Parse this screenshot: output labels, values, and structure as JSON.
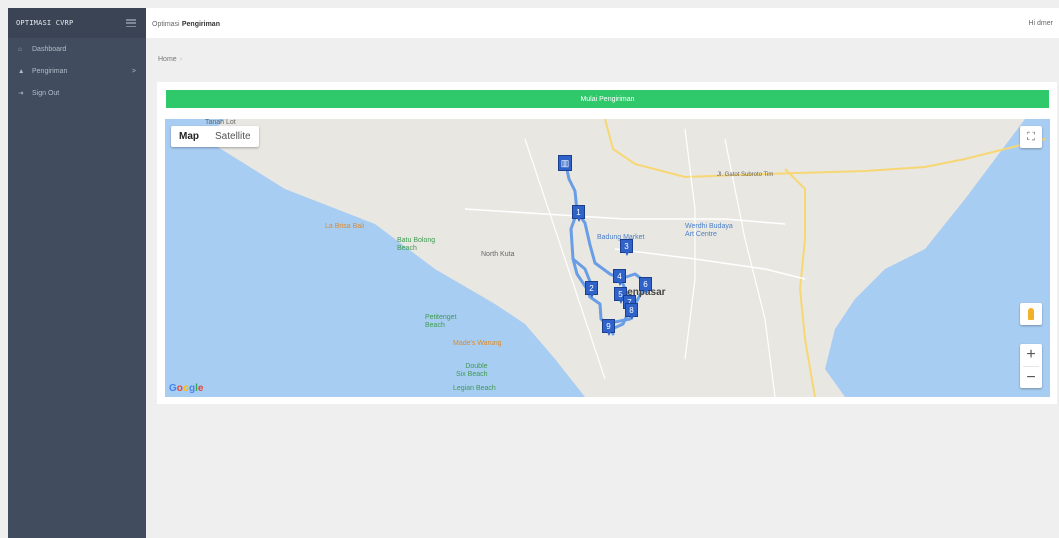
{
  "sidebar": {
    "brand": "OPTIMASI CVRP",
    "items": [
      {
        "icon": "home-icon",
        "label": "Dashboard"
      },
      {
        "icon": "user-icon",
        "label": "Pengiriman",
        "chevron": ">"
      },
      {
        "icon": "logout-icon",
        "label": "Sign Out"
      }
    ]
  },
  "header": {
    "title_prefix": "Optimasi",
    "title_emphasis": "Pengiriman",
    "greeting": "Hi dmer"
  },
  "breadcrumb": {
    "items": [
      "Home"
    ]
  },
  "main": {
    "start_button": "Mulai Pengiriman"
  },
  "map": {
    "type_buttons": [
      "Map",
      "Satellite"
    ],
    "attribution": "Google",
    "places": {
      "tanah_lot": "Tanah Lot",
      "la_brisa": "La Brisa Bali",
      "batu_bolong": "Batu Bolong\nBeach",
      "north_kuta": "North Kuta",
      "badung_market": "Badung Market",
      "werdhi_budaya": "Werdhi Budaya\nArt Centre",
      "denpasar": "Denpasar",
      "petitenget": "Petitenget\nBeach",
      "made_warung": "Made's Warung",
      "double_six": "Double\nSix Beach",
      "legian": "Legian Beach",
      "gatot_subroto": "Jl. Gatot Subroto Tim"
    },
    "markers": [
      "1",
      "2",
      "3",
      "4",
      "5",
      "6",
      "7",
      "8",
      "9"
    ],
    "colors": {
      "route": "#5b95e6",
      "marker": "#2f63c9",
      "sea": "#a8cdf3",
      "land": "#e9e7e2"
    }
  }
}
